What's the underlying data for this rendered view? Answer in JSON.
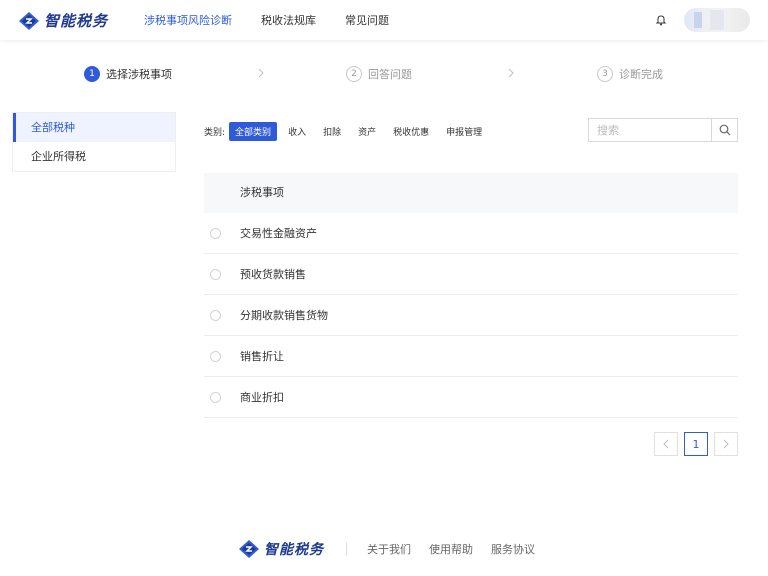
{
  "brand": {
    "name": "智能税务"
  },
  "nav": [
    "涉税事项风险诊断",
    "税收法规库",
    "常见问题"
  ],
  "steps": [
    {
      "num": "1",
      "label": "选择涉税事项"
    },
    {
      "num": "2",
      "label": "回答问题"
    },
    {
      "num": "3",
      "label": "诊断完成"
    }
  ],
  "sidebar": [
    "全部税种",
    "企业所得税"
  ],
  "filter": {
    "label": "类别:",
    "chips": [
      "全部类别",
      "收入",
      "扣除",
      "资产",
      "税收优惠",
      "申报管理"
    ]
  },
  "search": {
    "placeholder": "搜索"
  },
  "table": {
    "header": "涉税事项",
    "rows": [
      "交易性金融资产",
      "预收货款销售",
      "分期收款销售货物",
      "销售折让",
      "商业折扣"
    ]
  },
  "pagination": {
    "current": "1"
  },
  "footer": {
    "links": [
      "关于我们",
      "使用帮助",
      "服务协议"
    ]
  },
  "colors": {
    "accent": "#2f5bd8",
    "brand": "#1f3a8f"
  }
}
